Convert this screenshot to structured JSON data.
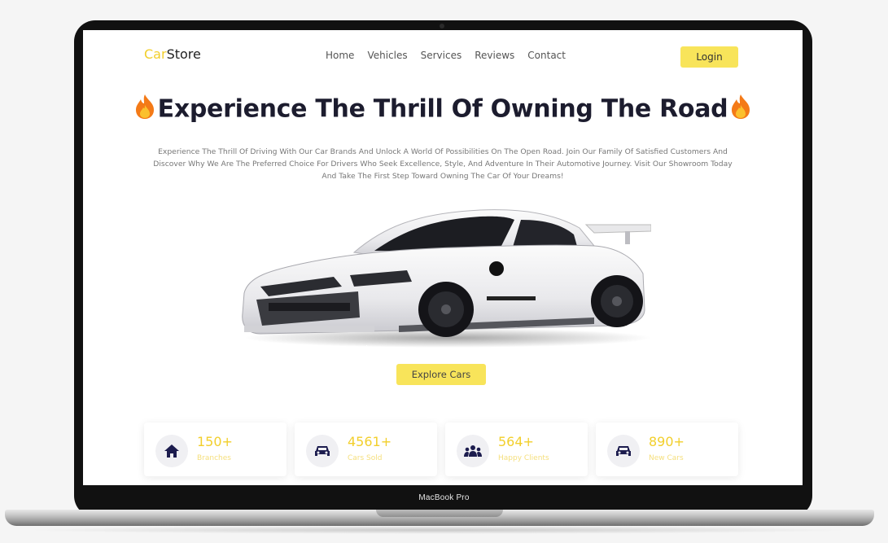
{
  "device": {
    "label": "MacBook Pro"
  },
  "brand": {
    "part1": "Car",
    "part2": "Store"
  },
  "nav": {
    "items": [
      "Home",
      "Vehicles",
      "Services",
      "Reviews",
      "Contact"
    ],
    "login_label": "Login"
  },
  "hero": {
    "title": "Experience The Thrill Of Owning The Road",
    "description": "Experience The Thrill Of Driving With Our Car Brands And Unlock A World Of Possibilities On The Open Road. Join Our Family Of Satisfied Customers And Discover Why We Are The Preferred Choice For Drivers Who Seek Excellence, Style, And Adventure In Their Automotive Journey. Visit Our Showroom Today And Take The First Step Toward Owning The Car Of Your Dreams!",
    "cta_label": "Explore Cars"
  },
  "stats": [
    {
      "value": "150+",
      "label": "Branches",
      "icon": "home-icon"
    },
    {
      "value": "4561+",
      "label": "Cars Sold",
      "icon": "car-icon"
    },
    {
      "value": "564+",
      "label": "Happy Clients",
      "icon": "users-icon"
    },
    {
      "value": "890+",
      "label": "New Cars",
      "icon": "car-icon"
    }
  ],
  "colors": {
    "accent": "#f8e45a",
    "brand_yellow": "#f2cf2b",
    "icon": "#1c1c4e",
    "title": "#1c1c2e"
  }
}
